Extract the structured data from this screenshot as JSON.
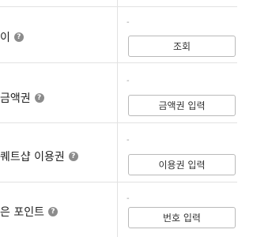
{
  "rows": [
    {
      "label": "이",
      "help_icon": "question-icon",
      "dash": "-",
      "button_label": "조회"
    },
    {
      "label": "금액권",
      "help_icon": "question-icon",
      "dash": "-",
      "button_label": "금액권 입력"
    },
    {
      "label": "퀘트샵 이용권",
      "help_icon": "question-icon",
      "dash": "-",
      "button_label": "이용권 입력"
    },
    {
      "label": "은 포인트",
      "help_icon": "question-icon",
      "dash": "-",
      "button_label": "번호 입력"
    }
  ],
  "colors": {
    "border": "#b9b9b9",
    "divider": "#e2e2e2",
    "help_icon_bg": "#8c8c8c"
  }
}
